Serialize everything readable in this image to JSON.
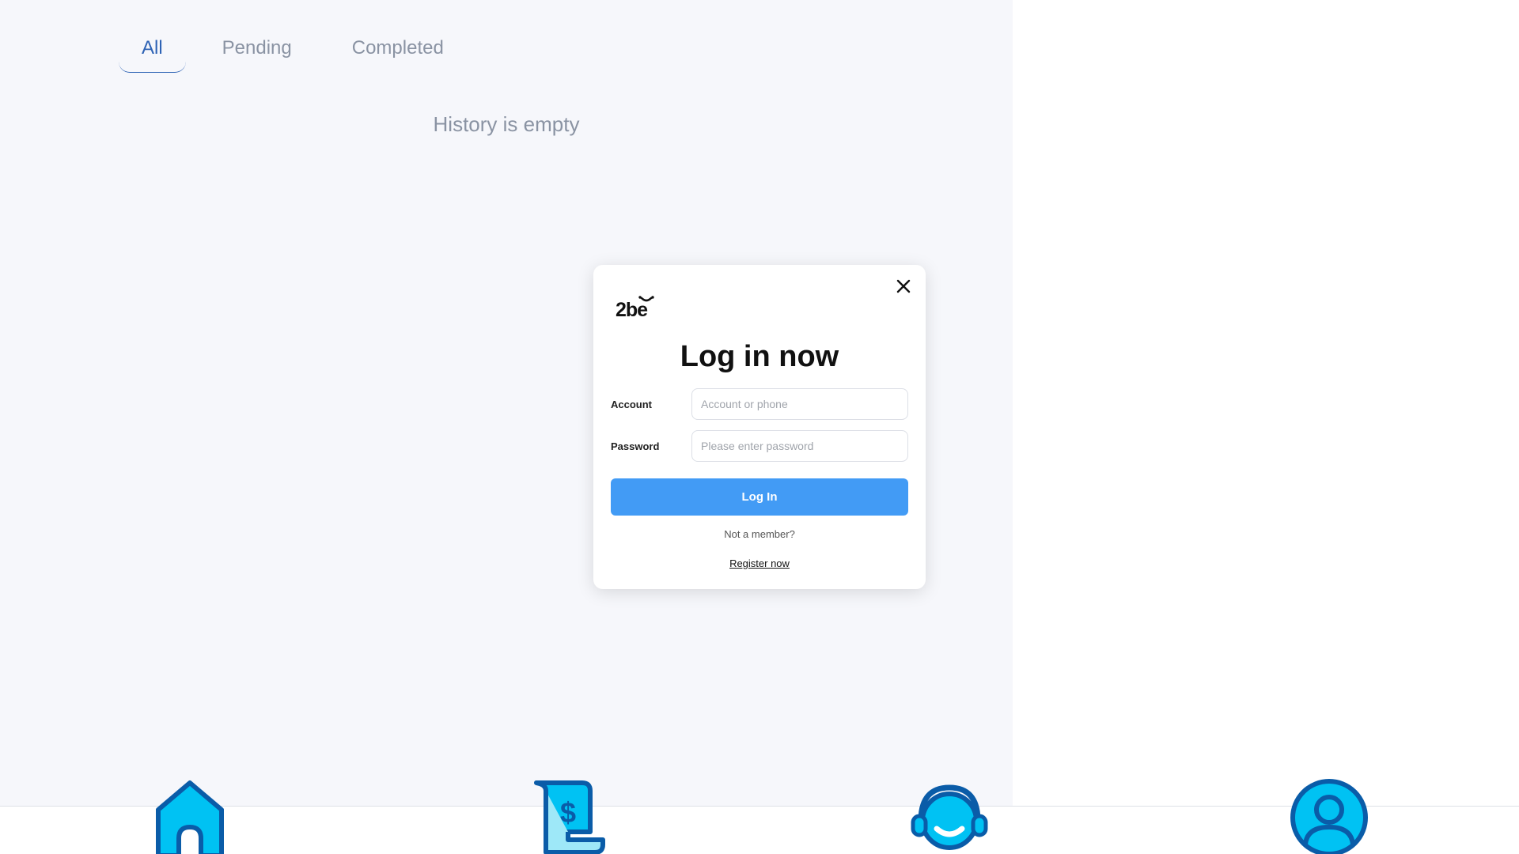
{
  "tabs": [
    {
      "label": "All",
      "active": true
    },
    {
      "label": "Pending",
      "active": false
    },
    {
      "label": "Completed",
      "active": false
    }
  ],
  "history": {
    "empty_message": "History is empty"
  },
  "login_modal": {
    "logo_text": "2be",
    "title": "Log in now",
    "account_label": "Account",
    "account_placeholder": "Account or phone",
    "account_value": "",
    "password_label": "Password",
    "password_placeholder": "Please enter password",
    "password_value": "",
    "login_button": "Log In",
    "not_member_text": "Not a member?",
    "register_link": "Register now",
    "close_icon": "close-icon"
  },
  "bottom_nav": [
    {
      "icon": "home-icon"
    },
    {
      "icon": "receipt-dollar-icon"
    },
    {
      "icon": "headset-support-icon"
    },
    {
      "icon": "user-profile-icon"
    }
  ],
  "colors": {
    "accent": "#2e63b5",
    "button": "#429bf5",
    "icon_fill": "#00c2f3",
    "icon_stroke": "#0a5ca8",
    "panel_bg": "#f6f7fb",
    "muted_text": "#8a93a3"
  }
}
